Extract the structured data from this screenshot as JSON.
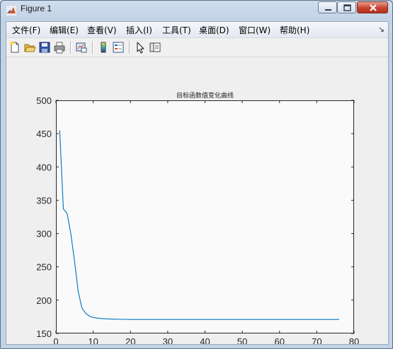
{
  "window": {
    "title": "Figure 1"
  },
  "menubar": {
    "items": [
      {
        "label": "文件(F)"
      },
      {
        "label": "编辑(E)"
      },
      {
        "label": "查看(V)"
      },
      {
        "label": "插入(I)"
      },
      {
        "label": "工具(T)"
      },
      {
        "label": "桌面(D)"
      },
      {
        "label": "窗口(W)"
      },
      {
        "label": "帮助(H)"
      }
    ],
    "overflow_icon": "double-arrow-icon"
  },
  "toolbar": {
    "buttons": [
      {
        "icon": "new-figure-icon"
      },
      {
        "icon": "open-file-icon"
      },
      {
        "icon": "save-icon"
      },
      {
        "icon": "print-icon"
      },
      {
        "icon": "link-plot-icon"
      },
      {
        "icon": "insert-colorbar-icon"
      },
      {
        "icon": "insert-legend-icon"
      },
      {
        "icon": "edit-plot-arrow-icon"
      },
      {
        "icon": "show-plot-tools-icon"
      }
    ]
  },
  "chart_data": {
    "type": "line",
    "title": "目标函数值变化曲线",
    "xlabel": "",
    "ylabel": "",
    "xlim": [
      0,
      80
    ],
    "ylim": [
      150,
      500
    ],
    "x_ticks": [
      "0",
      "10",
      "20",
      "30",
      "40",
      "50",
      "60",
      "70",
      "80"
    ],
    "y_ticks": [
      "150",
      "200",
      "250",
      "300",
      "350",
      "400",
      "450",
      "500"
    ],
    "grid": false,
    "series": [
      {
        "color": "#0072bd",
        "x": [
          1,
          2,
          3,
          4,
          5,
          6,
          7,
          8,
          9,
          10,
          12,
          14,
          16,
          18,
          20,
          25,
          30,
          40,
          50,
          60,
          70,
          76
        ],
        "y": [
          455,
          337,
          330,
          300,
          258,
          212,
          188,
          180,
          176,
          174,
          172.5,
          171.8,
          171.4,
          171.2,
          171,
          171,
          171,
          171,
          171,
          171,
          171,
          171
        ]
      }
    ]
  }
}
